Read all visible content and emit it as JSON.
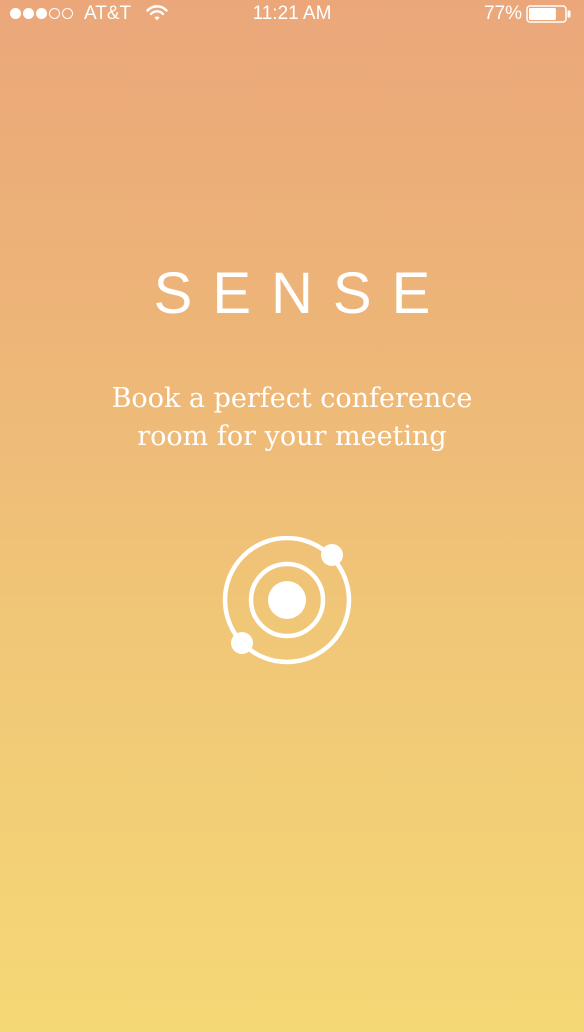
{
  "status_bar": {
    "signal_dots_filled": 3,
    "signal_dots_total": 5,
    "carrier": "AT&T",
    "wifi_icon": "wifi-icon",
    "time": "11:21 AM",
    "battery_percent": "77%",
    "battery_level": 0.77,
    "battery_icon": "battery-icon"
  },
  "splash": {
    "app_name": "SENSE",
    "tagline_line1": "Book a perfect conference",
    "tagline_line2": "room for your meeting",
    "logo_icon": "orbit-icon"
  },
  "colors": {
    "gradient_top": "#EBA77A",
    "gradient_bottom": "#F5D876",
    "text": "#FFFFFF"
  }
}
